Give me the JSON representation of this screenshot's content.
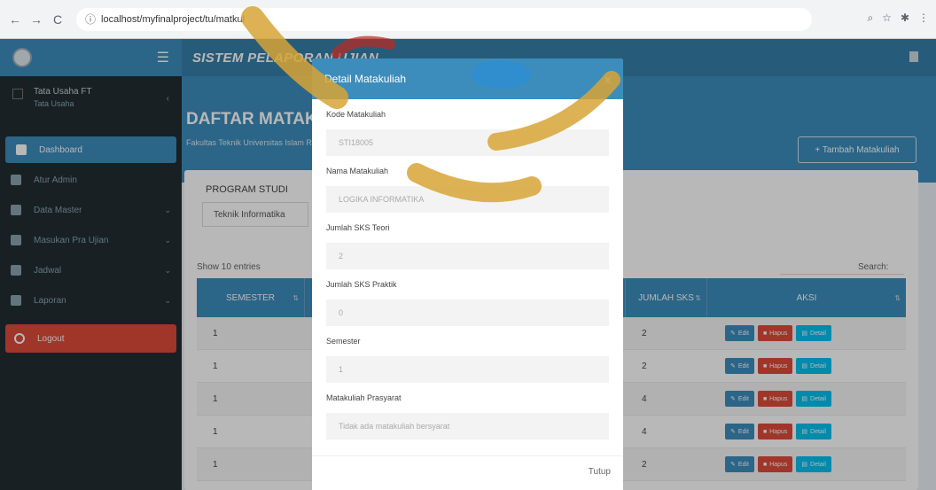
{
  "browser": {
    "url": "localhost/myfinalproject/tu/matkul",
    "back": "←",
    "forward": "→",
    "reload": "C",
    "info_icon": "ⓘ"
  },
  "app": {
    "title": "SISTEM PELAPORAN UJIAN",
    "colors": {
      "primary": "#3c8dbc",
      "sidebar": "#222d32",
      "danger": "#dd4b39",
      "info": "#00c0ef"
    }
  },
  "sidebar": {
    "user_name": "Tata Usaha FT",
    "user_role": "Tata Usaha",
    "items": [
      {
        "label": "Dashboard",
        "icon": "dashboard-icon",
        "active": true,
        "chevron": false
      },
      {
        "label": "Atur Admin",
        "icon": "user-icon",
        "active": false,
        "chevron": false
      },
      {
        "label": "Data Master",
        "icon": "database-icon",
        "active": false,
        "chevron": true
      },
      {
        "label": "Masukan Pra Ujian",
        "icon": "input-icon",
        "active": false,
        "chevron": true
      },
      {
        "label": "Jadwal",
        "icon": "calendar-icon",
        "active": false,
        "chevron": true
      },
      {
        "label": "Laporan",
        "icon": "report-icon",
        "active": false,
        "chevron": true
      }
    ],
    "logout": "Logout"
  },
  "content": {
    "page_title": "DAFTAR MATAKULIAH",
    "page_subtitle": "Fakultas Teknik Universitas Islam Riau",
    "add_button": "+ Tambah Matakuliah",
    "prodi_label": "PROGRAM STUDI",
    "prodi_value": "Teknik Informatika",
    "show_entries": "Show 10 entries",
    "search_label": "Search:",
    "table": {
      "headers": [
        "SEMESTER",
        "JUMLAH SKS",
        "AKSI"
      ],
      "rows": [
        {
          "semester": "1",
          "sks": "2"
        },
        {
          "semester": "1",
          "sks": "2"
        },
        {
          "semester": "1",
          "sks": "4"
        },
        {
          "semester": "1",
          "sks": "4"
        },
        {
          "semester": "1",
          "sks": "2"
        }
      ],
      "actions": {
        "edit": "Edit",
        "delete": "Hapus",
        "detail": "Detail"
      }
    }
  },
  "modal": {
    "title": "Detail Matakuliah",
    "close": "x",
    "fields": [
      {
        "label": "Kode Matakuliah",
        "value": "STI18005"
      },
      {
        "label": "Nama Matakuliah",
        "value": "LOGIKA INFORMATIKA"
      },
      {
        "label": "Jumlah SKS Teori",
        "value": "2"
      },
      {
        "label": "Jumlah SKS Praktik",
        "value": "0"
      },
      {
        "label": "Semester",
        "value": "1"
      },
      {
        "label": "Matakuliah Prasyarat",
        "value": "Tidak ada matakuliah bersyarat"
      }
    ],
    "footer_button": "Tutup"
  }
}
